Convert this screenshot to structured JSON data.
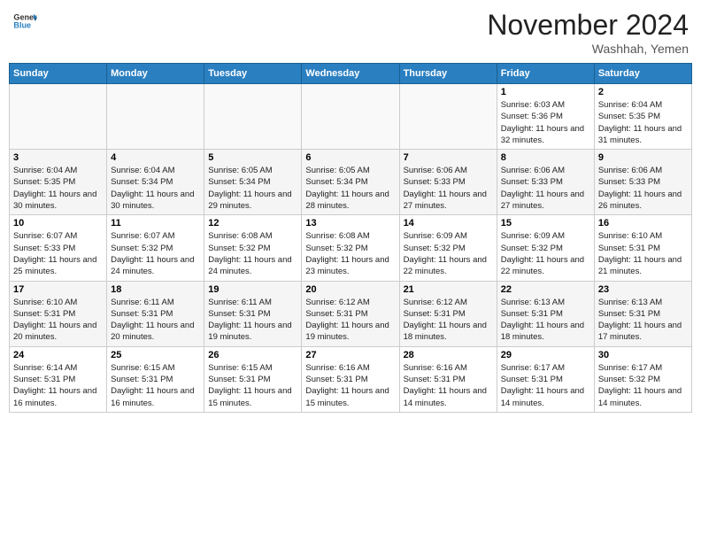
{
  "header": {
    "logo_line1": "General",
    "logo_line2": "Blue",
    "month": "November 2024",
    "location": "Washhah, Yemen"
  },
  "days_of_week": [
    "Sunday",
    "Monday",
    "Tuesday",
    "Wednesday",
    "Thursday",
    "Friday",
    "Saturday"
  ],
  "weeks": [
    [
      {
        "day": "",
        "info": ""
      },
      {
        "day": "",
        "info": ""
      },
      {
        "day": "",
        "info": ""
      },
      {
        "day": "",
        "info": ""
      },
      {
        "day": "",
        "info": ""
      },
      {
        "day": "1",
        "info": "Sunrise: 6:03 AM\nSunset: 5:36 PM\nDaylight: 11 hours and 32 minutes."
      },
      {
        "day": "2",
        "info": "Sunrise: 6:04 AM\nSunset: 5:35 PM\nDaylight: 11 hours and 31 minutes."
      }
    ],
    [
      {
        "day": "3",
        "info": "Sunrise: 6:04 AM\nSunset: 5:35 PM\nDaylight: 11 hours and 30 minutes."
      },
      {
        "day": "4",
        "info": "Sunrise: 6:04 AM\nSunset: 5:34 PM\nDaylight: 11 hours and 30 minutes."
      },
      {
        "day": "5",
        "info": "Sunrise: 6:05 AM\nSunset: 5:34 PM\nDaylight: 11 hours and 29 minutes."
      },
      {
        "day": "6",
        "info": "Sunrise: 6:05 AM\nSunset: 5:34 PM\nDaylight: 11 hours and 28 minutes."
      },
      {
        "day": "7",
        "info": "Sunrise: 6:06 AM\nSunset: 5:33 PM\nDaylight: 11 hours and 27 minutes."
      },
      {
        "day": "8",
        "info": "Sunrise: 6:06 AM\nSunset: 5:33 PM\nDaylight: 11 hours and 27 minutes."
      },
      {
        "day": "9",
        "info": "Sunrise: 6:06 AM\nSunset: 5:33 PM\nDaylight: 11 hours and 26 minutes."
      }
    ],
    [
      {
        "day": "10",
        "info": "Sunrise: 6:07 AM\nSunset: 5:33 PM\nDaylight: 11 hours and 25 minutes."
      },
      {
        "day": "11",
        "info": "Sunrise: 6:07 AM\nSunset: 5:32 PM\nDaylight: 11 hours and 24 minutes."
      },
      {
        "day": "12",
        "info": "Sunrise: 6:08 AM\nSunset: 5:32 PM\nDaylight: 11 hours and 24 minutes."
      },
      {
        "day": "13",
        "info": "Sunrise: 6:08 AM\nSunset: 5:32 PM\nDaylight: 11 hours and 23 minutes."
      },
      {
        "day": "14",
        "info": "Sunrise: 6:09 AM\nSunset: 5:32 PM\nDaylight: 11 hours and 22 minutes."
      },
      {
        "day": "15",
        "info": "Sunrise: 6:09 AM\nSunset: 5:32 PM\nDaylight: 11 hours and 22 minutes."
      },
      {
        "day": "16",
        "info": "Sunrise: 6:10 AM\nSunset: 5:31 PM\nDaylight: 11 hours and 21 minutes."
      }
    ],
    [
      {
        "day": "17",
        "info": "Sunrise: 6:10 AM\nSunset: 5:31 PM\nDaylight: 11 hours and 20 minutes."
      },
      {
        "day": "18",
        "info": "Sunrise: 6:11 AM\nSunset: 5:31 PM\nDaylight: 11 hours and 20 minutes."
      },
      {
        "day": "19",
        "info": "Sunrise: 6:11 AM\nSunset: 5:31 PM\nDaylight: 11 hours and 19 minutes."
      },
      {
        "day": "20",
        "info": "Sunrise: 6:12 AM\nSunset: 5:31 PM\nDaylight: 11 hours and 19 minutes."
      },
      {
        "day": "21",
        "info": "Sunrise: 6:12 AM\nSunset: 5:31 PM\nDaylight: 11 hours and 18 minutes."
      },
      {
        "day": "22",
        "info": "Sunrise: 6:13 AM\nSunset: 5:31 PM\nDaylight: 11 hours and 18 minutes."
      },
      {
        "day": "23",
        "info": "Sunrise: 6:13 AM\nSunset: 5:31 PM\nDaylight: 11 hours and 17 minutes."
      }
    ],
    [
      {
        "day": "24",
        "info": "Sunrise: 6:14 AM\nSunset: 5:31 PM\nDaylight: 11 hours and 16 minutes."
      },
      {
        "day": "25",
        "info": "Sunrise: 6:15 AM\nSunset: 5:31 PM\nDaylight: 11 hours and 16 minutes."
      },
      {
        "day": "26",
        "info": "Sunrise: 6:15 AM\nSunset: 5:31 PM\nDaylight: 11 hours and 15 minutes."
      },
      {
        "day": "27",
        "info": "Sunrise: 6:16 AM\nSunset: 5:31 PM\nDaylight: 11 hours and 15 minutes."
      },
      {
        "day": "28",
        "info": "Sunrise: 6:16 AM\nSunset: 5:31 PM\nDaylight: 11 hours and 14 minutes."
      },
      {
        "day": "29",
        "info": "Sunrise: 6:17 AM\nSunset: 5:31 PM\nDaylight: 11 hours and 14 minutes."
      },
      {
        "day": "30",
        "info": "Sunrise: 6:17 AM\nSunset: 5:32 PM\nDaylight: 11 hours and 14 minutes."
      }
    ]
  ]
}
